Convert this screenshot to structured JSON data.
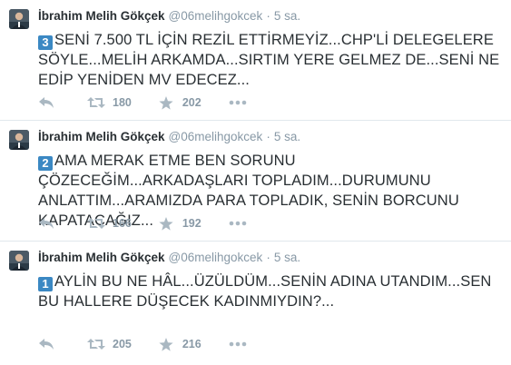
{
  "tweets": [
    {
      "name": "İbrahim Melih Gökçek",
      "handle": "@06melihgokcek",
      "separator": "·",
      "time": "5 sa.",
      "badge": "3",
      "text": "SENİ 7.500 TL İÇİN REZİL ETTİRMEYİZ...CHP'Lİ DELEGELERE SÖYLE...MELİH ARKAMDA...SIRTIM YERE GELMEZ DE...SENİ NE EDİP YENİDEN MV EDECEZ...",
      "retweets": "180",
      "favorites": "202"
    },
    {
      "name": "İbrahim Melih Gökçek",
      "handle": "@06melihgokcek",
      "separator": "·",
      "time": "5 sa.",
      "badge": "2",
      "text": "AMA MERAK ETME BEN SORUNU ÇÖZECEĞİM...ARKADAŞLARI TOPLADIM...DURUMUNU ANLATTIM...ARAMIZDA PARA TOPLADIK, SENİN BORCUNU KAPATACAĞIZ...",
      "retweets": "166",
      "favorites": "192"
    },
    {
      "name": "İbrahim Melih Gökçek",
      "handle": "@06melihgokcek",
      "separator": "·",
      "time": "5 sa.",
      "badge": "1",
      "text": "AYLİN BU NE HÂL...ÜZÜLDÜM...SENİN ADINA UTANDIM...SEN BU HALLERE DÜŞECEK KADINMIYDIN?...",
      "retweets": "205",
      "favorites": "216"
    }
  ],
  "colors": {
    "text": "#292f33",
    "muted": "#8899a6",
    "icon": "#aab8c2",
    "badge": "#3b88c3",
    "divider": "#e1e8ed"
  },
  "icons": [
    "avatar",
    "reply-icon",
    "retweet-icon",
    "favorite-star-icon",
    "more-dots-icon"
  ]
}
